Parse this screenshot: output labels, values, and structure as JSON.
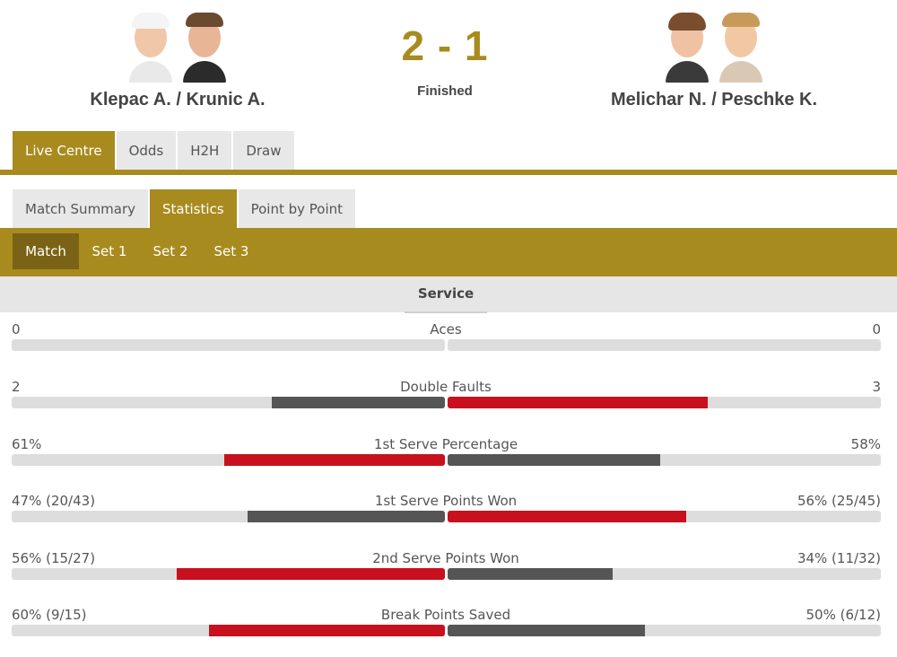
{
  "match": {
    "home_team": "Klepac A. / Krunic A.",
    "away_team": "Melichar N. / Peschke K.",
    "score": "2 - 1",
    "status": "Finished"
  },
  "main_tabs": [
    "Live Centre",
    "Odds",
    "H2H",
    "Draw"
  ],
  "sub_tabs": [
    "Match Summary",
    "Statistics",
    "Point by Point"
  ],
  "set_tabs": [
    "Match",
    "Set 1",
    "Set 2",
    "Set 3"
  ],
  "section": {
    "title": "Service"
  },
  "colors": {
    "accent": "#a88b1f",
    "accent_dark": "#7a6314",
    "winner": "#c8101e",
    "loser": "#555555",
    "track": "#dddddd"
  },
  "stats": [
    {
      "label": "Aces",
      "home": "0",
      "away": "0",
      "home_pct": 0,
      "away_pct": 0,
      "home_color": "#555555",
      "away_color": "#555555"
    },
    {
      "label": "Double Faults",
      "home": "2",
      "away": "3",
      "home_pct": 40,
      "away_pct": 60,
      "home_color": "#555555",
      "away_color": "#c8101e"
    },
    {
      "label": "1st Serve Percentage",
      "home": "61%",
      "away": "58%",
      "home_pct": 51,
      "away_pct": 49,
      "home_color": "#c8101e",
      "away_color": "#555555"
    },
    {
      "label": "1st Serve Points Won",
      "home": "47% (20/43)",
      "away": "56% (25/45)",
      "home_pct": 45.5,
      "away_pct": 55,
      "home_color": "#555555",
      "away_color": "#c8101e"
    },
    {
      "label": "2nd Serve Points Won",
      "home": "56% (15/27)",
      "away": "34% (11/32)",
      "home_pct": 62,
      "away_pct": 38,
      "home_color": "#c8101e",
      "away_color": "#555555"
    },
    {
      "label": "Break Points Saved",
      "home": "60% (9/15)",
      "away": "50% (6/12)",
      "home_pct": 54.5,
      "away_pct": 45.5,
      "home_color": "#c8101e",
      "away_color": "#555555"
    }
  ]
}
